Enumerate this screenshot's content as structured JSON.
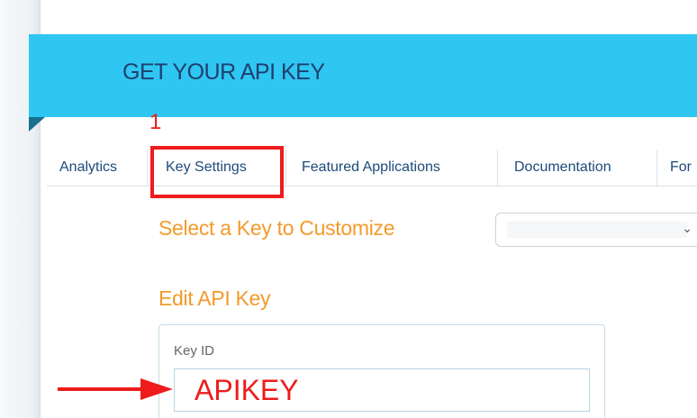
{
  "header": {
    "title": "GET YOUR API KEY"
  },
  "nav": {
    "tabs": [
      {
        "label": "Analytics"
      },
      {
        "label": "Key Settings"
      },
      {
        "label": "Featured Applications"
      },
      {
        "label": "Documentation"
      },
      {
        "label": "For"
      }
    ]
  },
  "main": {
    "select_heading": "Select a Key to Customize",
    "select_value": "",
    "edit_heading": "Edit API Key",
    "key_id_label": "Key ID",
    "key_id_value": "APIKEY"
  },
  "annotations": {
    "step_number": "1"
  },
  "colors": {
    "banner": "#2fc6f2",
    "banner_title": "#1f3f6e",
    "nav_text": "#1d4a7a",
    "heading_orange": "#f39a2a",
    "annotation_red": "#ee1c1c"
  },
  "icons": {
    "select_dropdown": "chevron-down-icon",
    "pointer_arrow": "right-arrow-icon"
  }
}
